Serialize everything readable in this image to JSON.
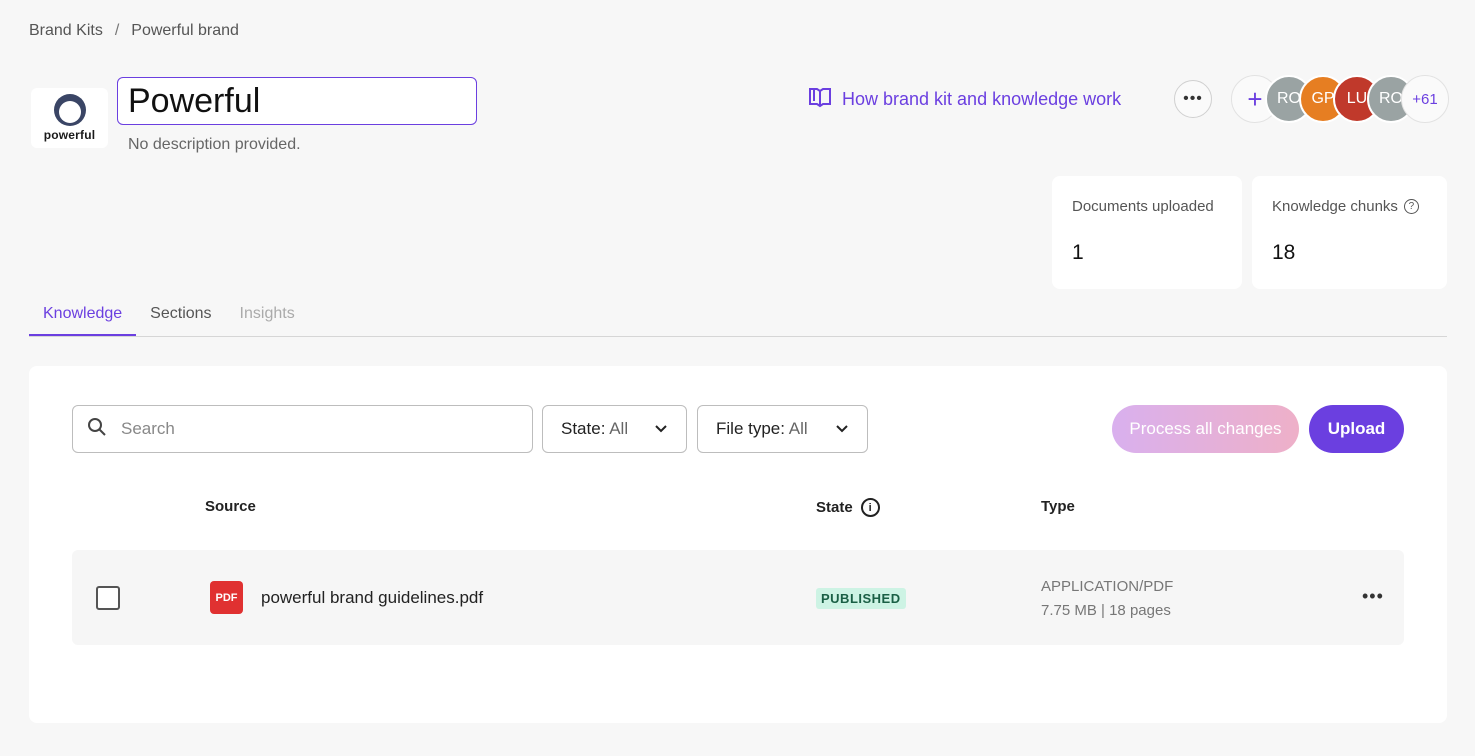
{
  "breadcrumb": {
    "root": "Brand Kits",
    "separator": "/",
    "current": "Powerful brand"
  },
  "brand": {
    "logo_text": "powerful",
    "name": "Powerful",
    "description": "No description provided."
  },
  "header": {
    "howto_label": "How brand kit and knowledge work",
    "more_label": "•••"
  },
  "collaborators": {
    "add_label": "+",
    "avatars": [
      {
        "initials": "RO",
        "color": "#9aa3a3"
      },
      {
        "initials": "GP",
        "color": "#e67e22"
      },
      {
        "initials": "LU",
        "color": "#c0392b"
      },
      {
        "initials": "RO",
        "color": "#9aa3a3"
      }
    ],
    "overflow_label": "+61"
  },
  "stats": {
    "documents": {
      "label": "Documents uploaded",
      "value": "1"
    },
    "chunks": {
      "label": "Knowledge chunks",
      "value": "18",
      "help_icon": "?"
    }
  },
  "tabs": [
    {
      "label": "Knowledge"
    },
    {
      "label": "Sections"
    },
    {
      "label": "Insights"
    }
  ],
  "toolbar": {
    "search_placeholder": "Search",
    "state_label": "State:",
    "state_value": "All",
    "filetype_label": "File type:",
    "filetype_value": "All",
    "process_label": "Process all changes",
    "upload_label": "Upload"
  },
  "table": {
    "headers": {
      "source": "Source",
      "state": "State",
      "state_info": "i",
      "type": "Type"
    },
    "rows": [
      {
        "icon_label": "PDF",
        "filename": "powerful brand guidelines.pdf",
        "state": "PUBLISHED",
        "type": "APPLICATION/PDF",
        "meta": "7.75 MB | 18 pages",
        "more": "•••"
      }
    ]
  },
  "colors": {
    "accent": "#6b3fe0",
    "published_bg": "#cdf3e4",
    "pdf_red": "#e03131"
  }
}
